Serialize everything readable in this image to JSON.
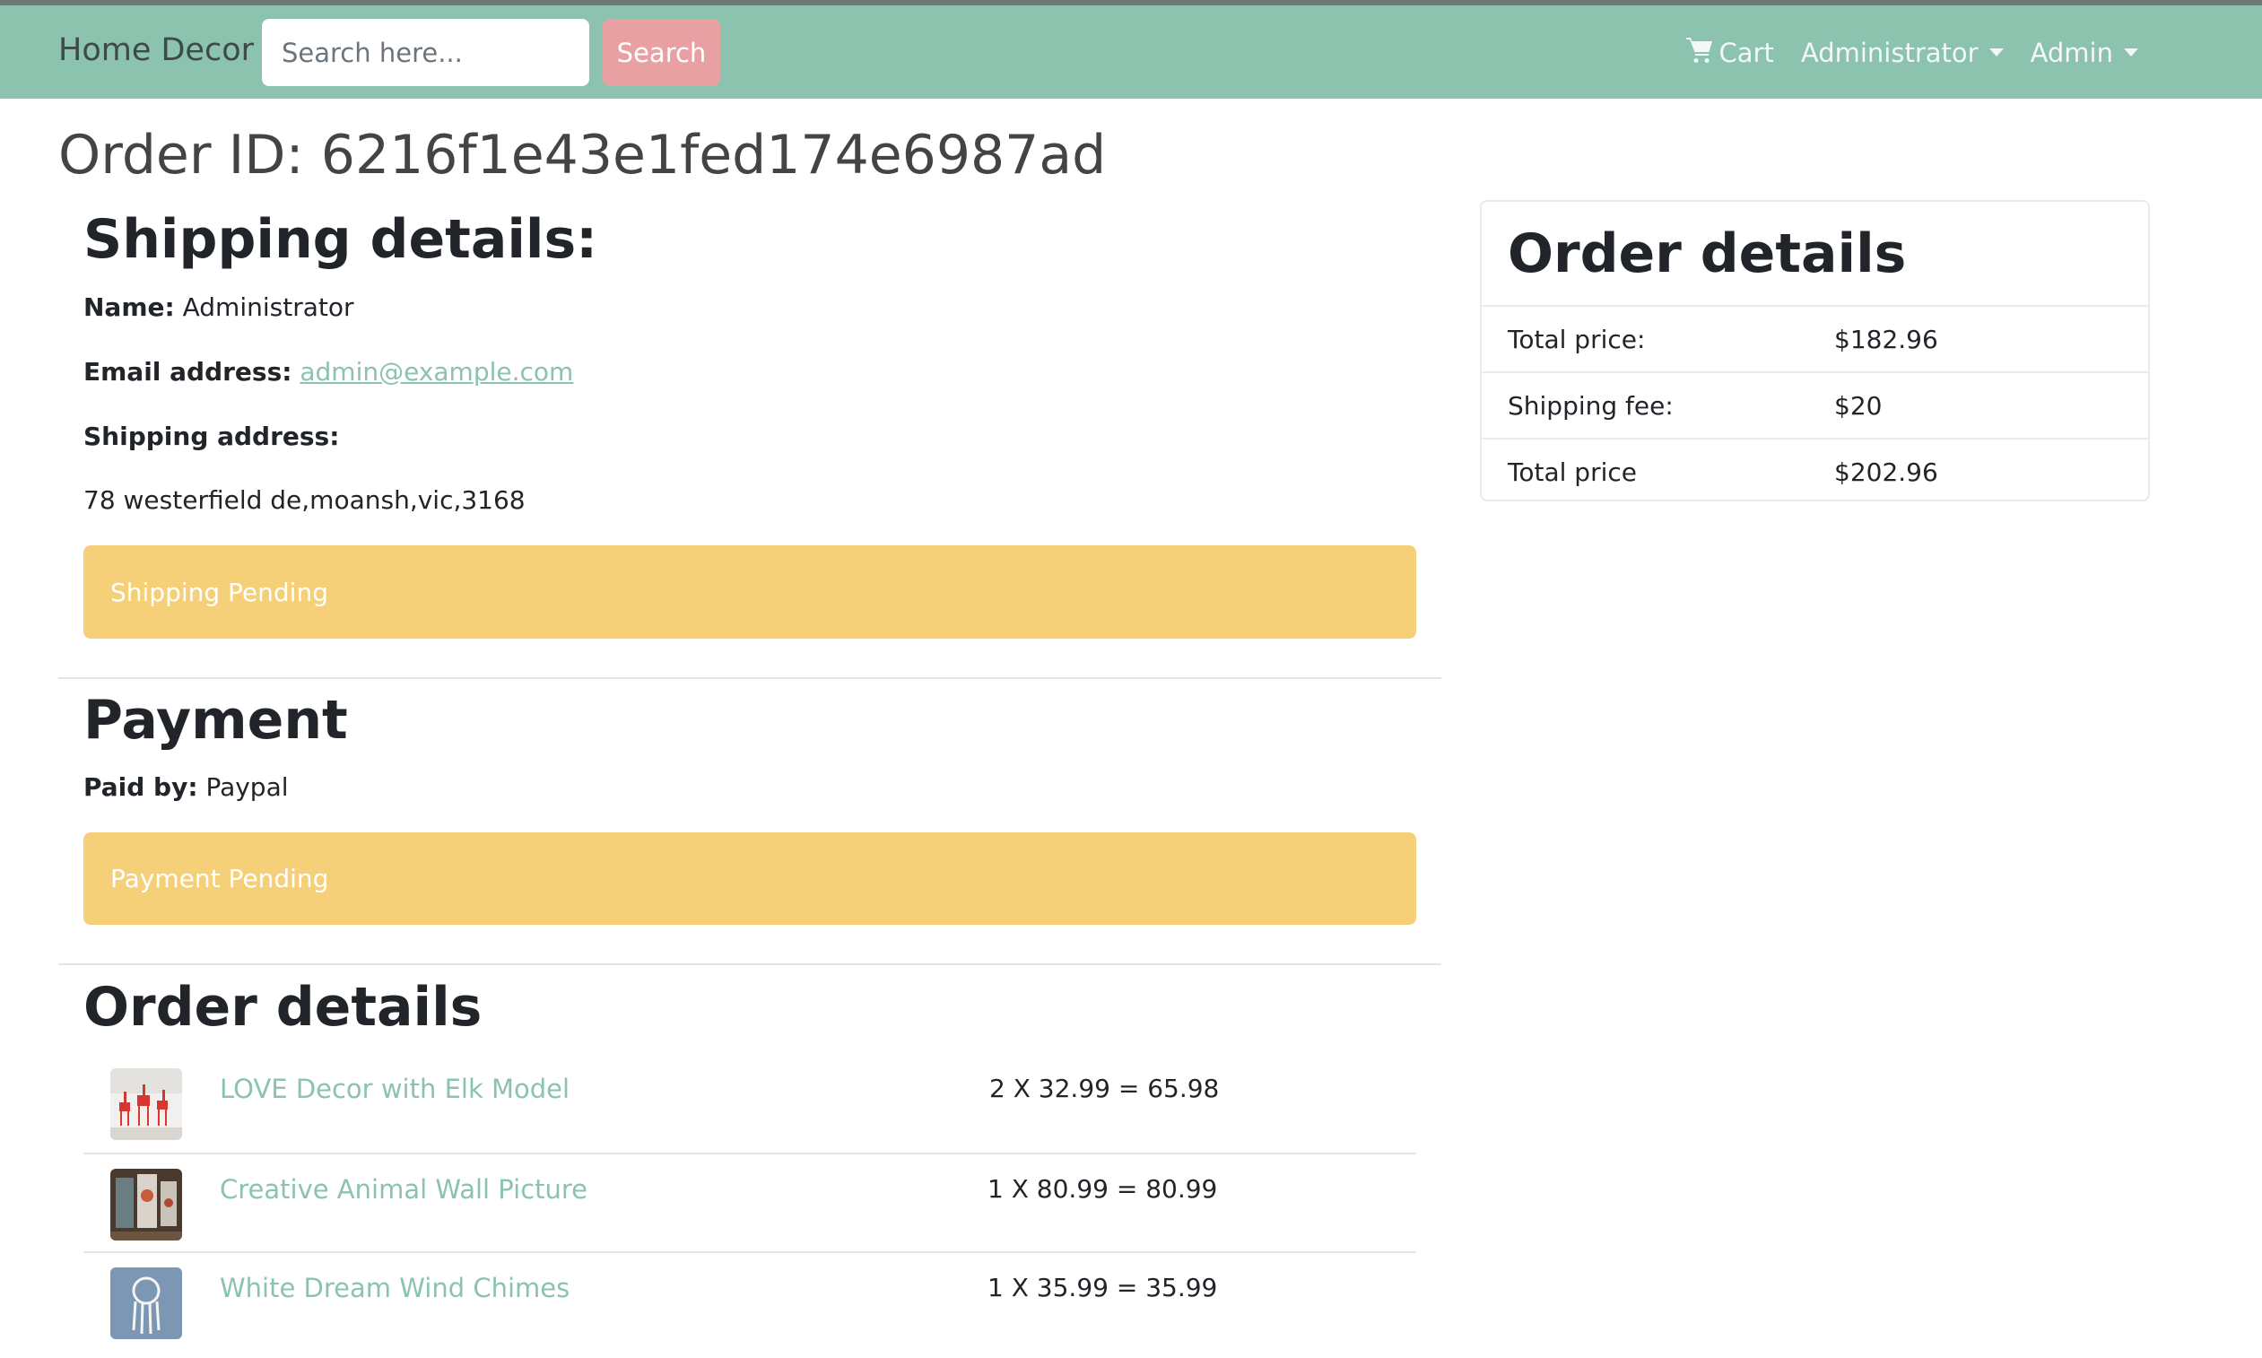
{
  "navbar": {
    "brand": "Home Decor",
    "search_placeholder": "Search here...",
    "search_button": "Search",
    "cart_label": "Cart",
    "cart_icon": "cart-icon",
    "user_menu": "Administrator",
    "admin_menu": "Admin",
    "bg_color": "#8bc3ae",
    "search_button_color": "#e8a0a2"
  },
  "order": {
    "title": "Order ID:  6216f1e43e1fed174e6987ad"
  },
  "shipping": {
    "heading": "Shipping details:",
    "name_label": "Name:",
    "name_value": "Administrator",
    "email_label": "Email address:",
    "email_value": "admin@example.com",
    "address_label": "Shipping address:",
    "address_value": "78 westerfield de,moansh,vic,3168",
    "status": "Shipping Pending"
  },
  "payment": {
    "heading": "Payment",
    "paid_by_label": "Paid by:",
    "paid_by_value": "Paypal",
    "status": "Payment Pending"
  },
  "items": {
    "heading": "Order details",
    "list": [
      {
        "name": "LOVE Decor with Elk Model",
        "calc": "2 X 32.99 = 65.98",
        "thumb_icon": "elk-decor-thumbnail"
      },
      {
        "name": "Creative Animal Wall Picture",
        "calc": "1 X 80.99 = 80.99",
        "thumb_icon": "wall-picture-thumbnail"
      },
      {
        "name": "White Dream Wind Chimes",
        "calc": "1 X 35.99 = 35.99",
        "thumb_icon": "wind-chimes-thumbnail"
      }
    ]
  },
  "summary": {
    "heading": "Order details",
    "rows": [
      {
        "label": "Total price:",
        "value": "$182.96"
      },
      {
        "label": "Shipping fee:",
        "value": "$20"
      },
      {
        "label": "Total price",
        "value": "$202.96"
      }
    ]
  },
  "colors": {
    "status_warning": "#f6cf79",
    "link": "#8bc3ae"
  }
}
